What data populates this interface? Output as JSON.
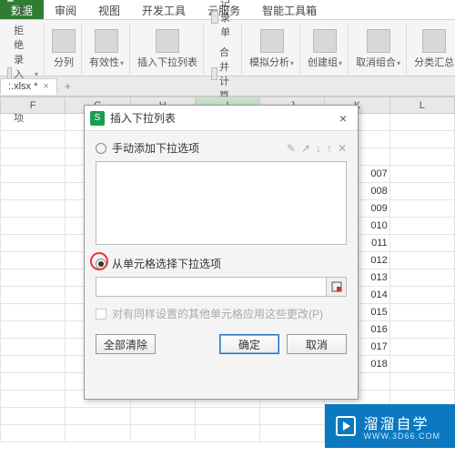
{
  "tabs": {
    "items": [
      "数据",
      "审阅",
      "视图",
      "开发工具",
      "云服务",
      "智能工具箱"
    ],
    "active_index": 0
  },
  "ribbon": {
    "dup_remove": "删除重复项",
    "reject_dup": "拒绝录入重复项",
    "split": "分列",
    "validity": "有效性",
    "insert_dropdown": "插入下拉列表",
    "record_form": "记录单",
    "consolidate": "合并计算",
    "simulate": "模拟分析",
    "create_group": "创建组",
    "ungroup": "取消组合",
    "subtotal": "分类汇总"
  },
  "file": {
    "name": ":.xlsx *",
    "close": "×",
    "add": "+"
  },
  "grid": {
    "cols": [
      "F",
      "G",
      "H",
      "I",
      "J",
      "K",
      "L"
    ],
    "active_col_index": 3,
    "k_values": [
      "007",
      "008",
      "009",
      "010",
      "011",
      "012",
      "013",
      "014",
      "015",
      "016",
      "017",
      "018"
    ]
  },
  "dialog": {
    "title": "插入下拉列表",
    "radio_manual": "手动添加下拉选项",
    "radio_range": "从单元格选择下拉选项",
    "range_value": "",
    "apply_label": "对有同样设置的其他单元格应用这些更改(P)",
    "clear": "全部清除",
    "ok": "确定",
    "cancel": "取消",
    "close": "×",
    "logo": "S",
    "mini_icons": [
      "✎",
      "↗",
      "↓",
      "↑",
      "✕"
    ]
  },
  "watermark": {
    "brand": "溜溜自学",
    "sub": "WWW.3D66.COM"
  }
}
